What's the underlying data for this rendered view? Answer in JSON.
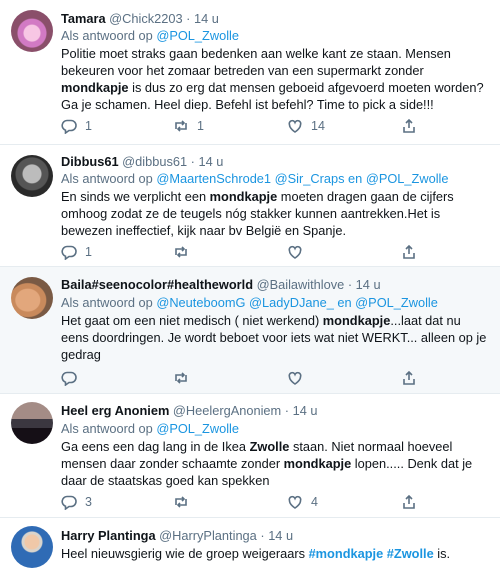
{
  "tweets": [
    {
      "display_name": "Tamara",
      "handle": "@Chick2203",
      "sep": "·",
      "time": "14 u",
      "reply_prefix": "Als antwoord op",
      "reply_mentions": "@POL_Zwolle",
      "text_before": "Politie moet straks gaan bedenken aan welke kant ze staan. Mensen bekeuren voor het zomaar betreden van een supermarkt zonder",
      "text_bold": "mondkapje",
      "text_after": "is dus zo erg dat mensen geboeid afgevoerd moeten worden? Ga je schamen. Heel diep. Befehl ist befehl? Time to pick a side!!!",
      "replies": "1",
      "retweets": "1",
      "likes": "14"
    },
    {
      "display_name": "Dibbus61",
      "handle": "@dibbus61",
      "sep": "·",
      "time": "14 u",
      "reply_prefix": "Als antwoord op",
      "reply_mentions": "@MaartenSchrode1 @Sir_Craps en @POL_Zwolle",
      "text_before": "En sinds we verplicht een",
      "text_bold": "mondkapje",
      "text_after": "moeten dragen gaan de cijfers omhoog zodat ze de teugels nóg stakker kunnen aantrekken.Het is bewezen ineffectief, kijk naar bv België en Spanje.",
      "replies": "1",
      "retweets": "",
      "likes": ""
    },
    {
      "display_name": "Baila#seenocolor#healtheworld",
      "handle": "@Bailawithlove",
      "sep": "·",
      "time": "14 u",
      "reply_prefix": "Als antwoord op",
      "reply_mentions": "@NeuteboomG @LadyDJane_ en @POL_Zwolle",
      "text_before": "Het gaat om een niet medisch ( niet werkend)",
      "text_bold": "mondkapje",
      "text_after": "...laat dat nu eens doordringen. Je wordt beboet voor iets wat niet WERKT... alleen op je gedrag",
      "replies": "",
      "retweets": "",
      "likes": ""
    },
    {
      "display_name": "Heel erg Anoniem",
      "handle": "@HeelergAnoniem",
      "sep": "·",
      "time": "14 u",
      "reply_prefix": "Als antwoord op",
      "reply_mentions": "@POL_Zwolle",
      "text_before": "Ga eens een dag lang in de Ikea",
      "text_bold_1": "Zwolle",
      "text_mid": "staan. Niet normaal hoeveel mensen daar zonder schaamte zonder",
      "text_bold": "mondkapje",
      "text_after": "lopen..... Denk dat je daar de staatskas goed kan spekken",
      "replies": "3",
      "retweets": "",
      "likes": "4"
    },
    {
      "display_name": "Harry Plantinga",
      "handle": "@HarryPlantinga",
      "sep": "·",
      "time": "14 u",
      "text_before": "Heel nieuwsgierig wie de groep weigeraars",
      "hashtag_1": "#mondkapje",
      "hashtag_2": "#Zwolle",
      "text_after": "is."
    }
  ],
  "icons": {
    "reply": "reply-icon",
    "retweet": "retweet-icon",
    "like": "like-icon",
    "share": "share-icon"
  },
  "colors": {
    "link": "#1b95e0",
    "meta": "#5b7083",
    "shaded_row": "#f5f8fa"
  }
}
